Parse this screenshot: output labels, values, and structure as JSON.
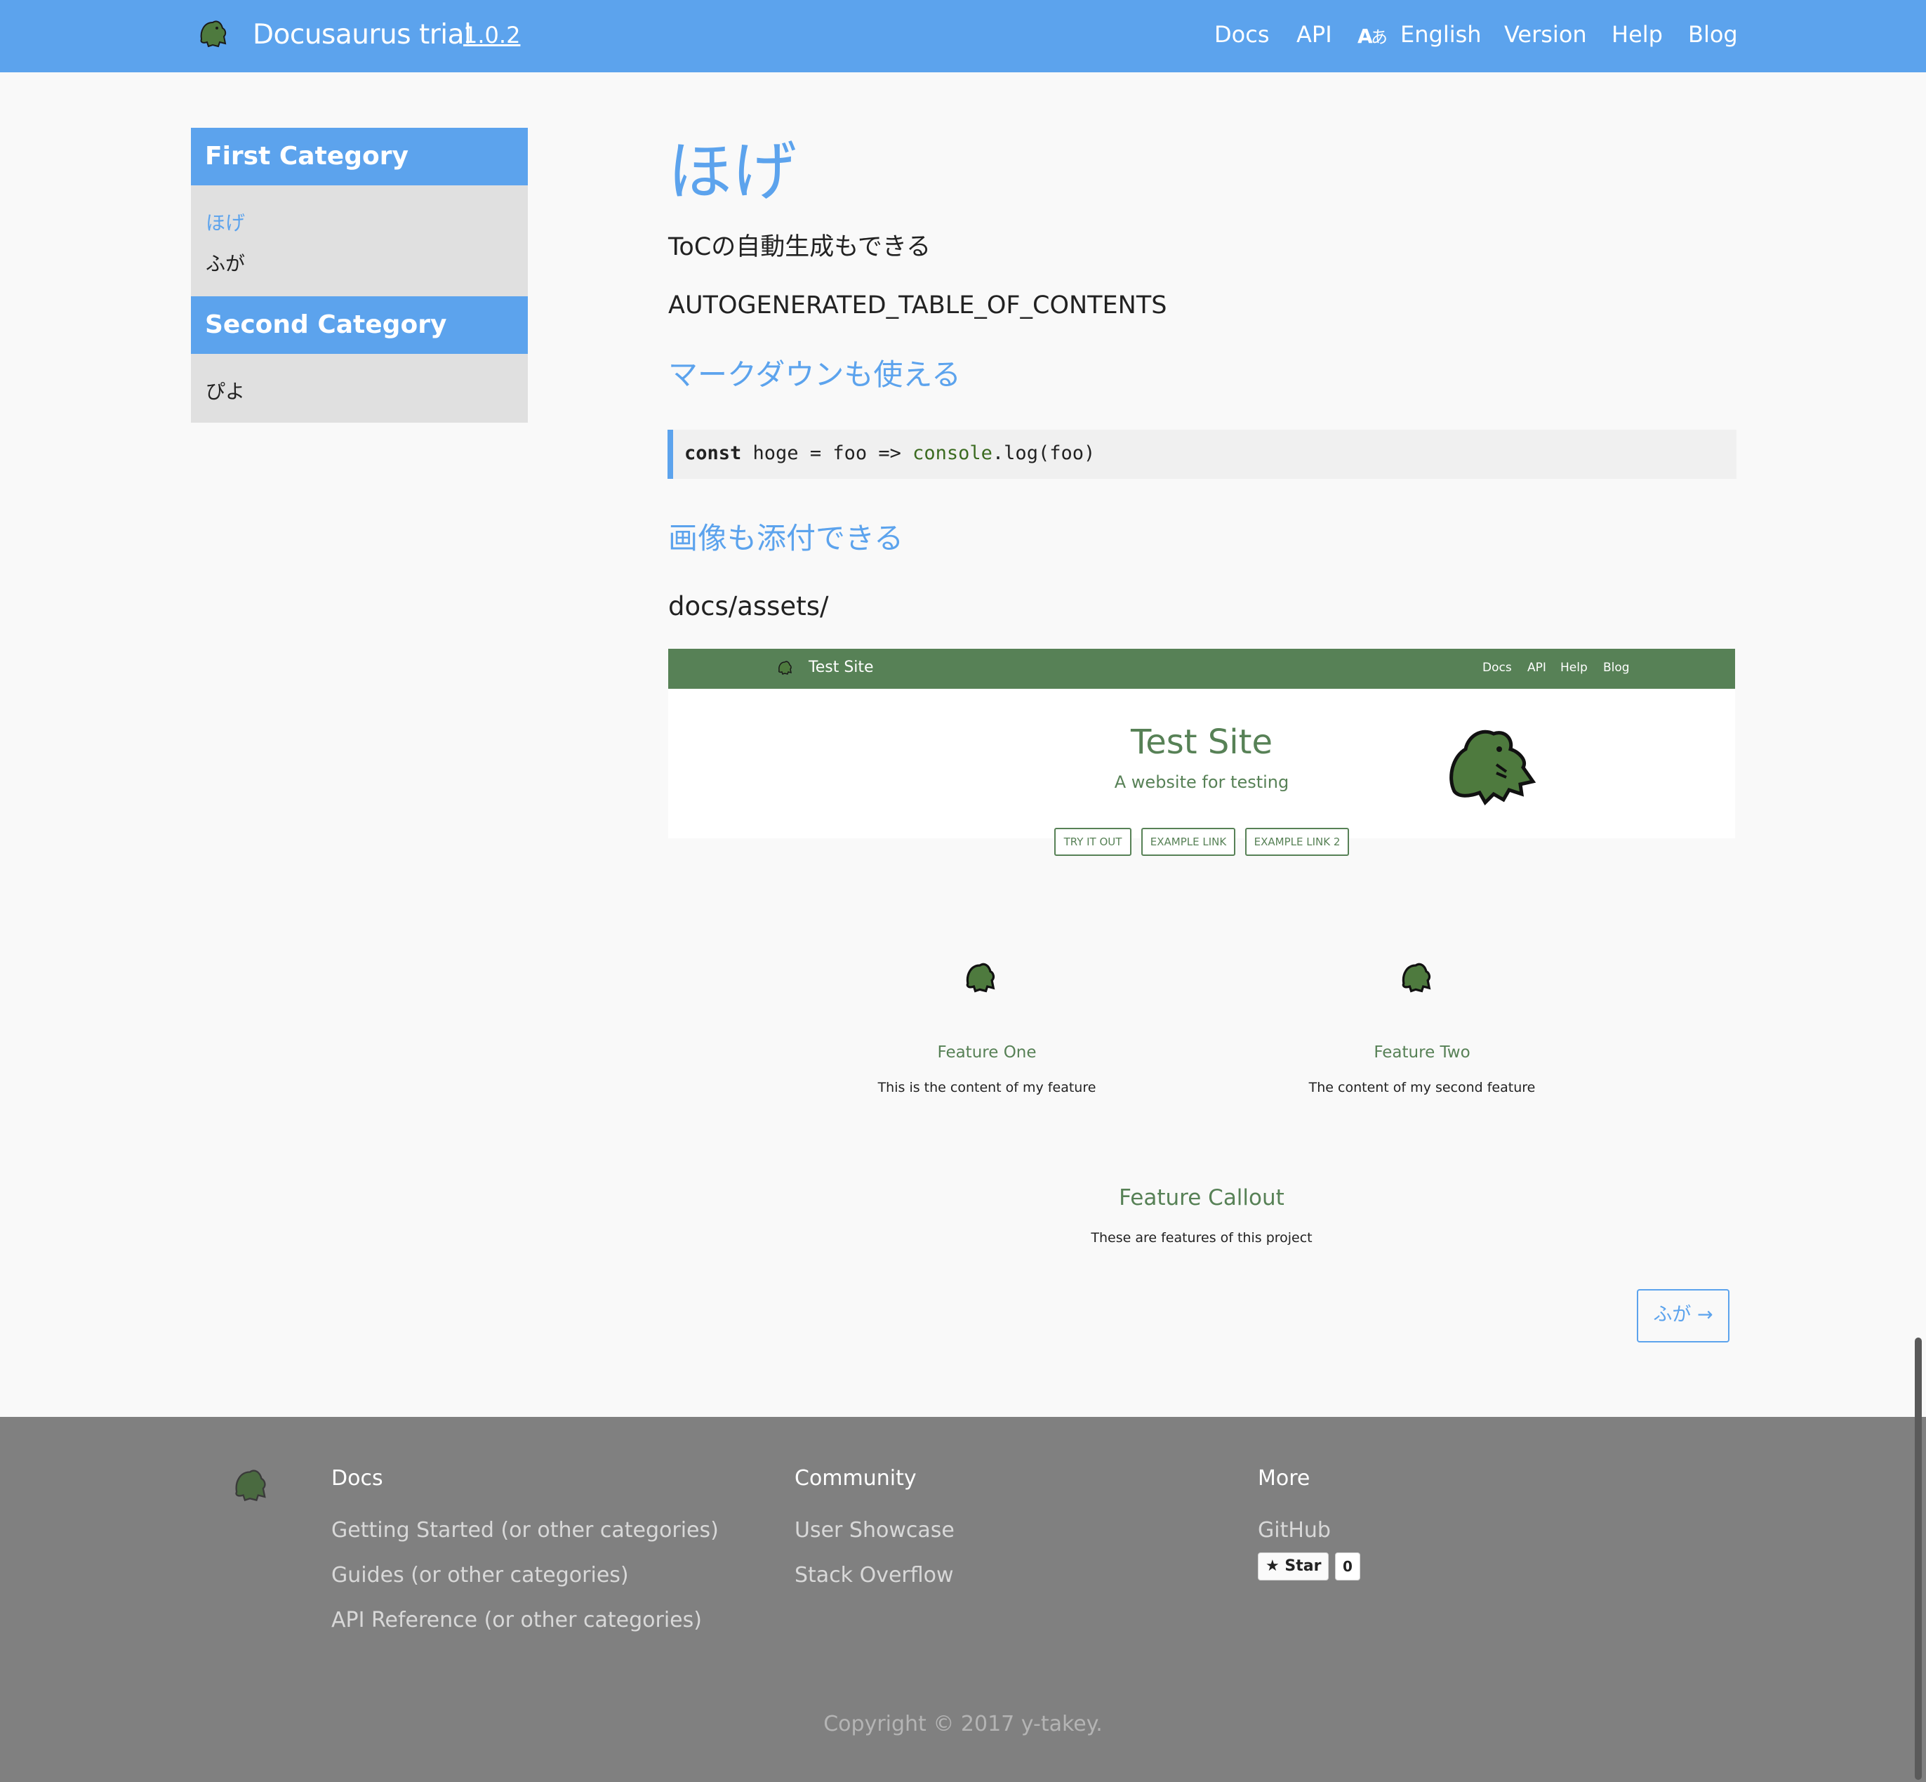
{
  "header": {
    "site_title": "Docusaurus trial",
    "version": "1.0.2",
    "nav": [
      "Docs",
      "API",
      "English",
      "Version",
      "Help",
      "Blog"
    ],
    "lang_icon": "translate-icon",
    "logo_icon": "dinosaur-logo-icon"
  },
  "sidebar": {
    "categories": [
      {
        "title": "First Category",
        "items": [
          "ほげ",
          "ふが"
        ]
      },
      {
        "title": "Second Category",
        "items": [
          "ぴよ"
        ]
      }
    ],
    "active_item": "ほげ"
  },
  "main": {
    "title": "ほげ",
    "toc_note": "ToCの自動生成もできる",
    "toc_placeholder": "AUTOGENERATED_TABLE_OF_CONTENTS",
    "h2_markdown": "マークダウンも使える",
    "code": {
      "kw": "const",
      "pre": " hoge = foo => ",
      "builtin": "console",
      "post": ".log(foo)"
    },
    "h2_image": "画像も添付できる",
    "image_path": "docs/assets/",
    "screenshot": {
      "bar_title": "Test Site",
      "bar_nav": [
        "Docs",
        "API",
        "Help",
        "Blog"
      ],
      "hero_title": "Test Site",
      "hero_tagline": "A website for testing",
      "buttons": [
        "TRY IT OUT",
        "EXAMPLE LINK",
        "EXAMPLE LINK 2"
      ],
      "features": [
        {
          "title": "Feature One",
          "text": "This is the content of my feature"
        },
        {
          "title": "Feature Two",
          "text": "The content of my second feature"
        }
      ],
      "callout_title": "Feature Callout",
      "callout_text": "These are features of this project"
    },
    "next_button": "ふが →"
  },
  "footer": {
    "columns": [
      {
        "title": "Docs",
        "links": [
          "Getting Started (or other categories)",
          "Guides (or other categories)",
          "API Reference (or other categories)"
        ]
      },
      {
        "title": "Community",
        "links": [
          "User Showcase",
          "Stack Overflow"
        ]
      },
      {
        "title": "More",
        "links": [
          "GitHub"
        ]
      }
    ],
    "star_label": "Star",
    "star_count": "0",
    "copyright": "Copyright © 2017 y-takey."
  },
  "colors": {
    "primary": "#5ca3ed",
    "secondary_green": "#578156",
    "footer_bg": "#808080"
  }
}
